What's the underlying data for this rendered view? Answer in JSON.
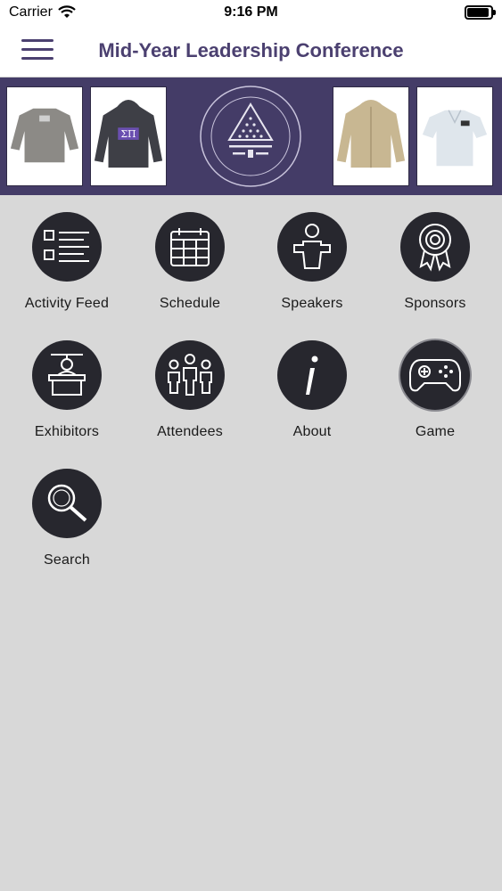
{
  "status": {
    "carrier": "Carrier",
    "time": "9:16 PM"
  },
  "nav": {
    "title": "Mid-Year Leadership Conference"
  },
  "banner": {
    "products": [
      "gray-sweatshirt",
      "hoodie-with-letters",
      "tan-jacket",
      "polo-shirt"
    ],
    "seal_text": "THE OFFICIAL STORE OF SIGMA PI FRATERNITY",
    "letters": "ΣΠ"
  },
  "menu": [
    {
      "label": "Activity Feed",
      "icon": "list-icon"
    },
    {
      "label": "Schedule",
      "icon": "calendar-icon"
    },
    {
      "label": "Speakers",
      "icon": "speaker-podium-icon"
    },
    {
      "label": "Sponsors",
      "icon": "award-ribbon-icon"
    },
    {
      "label": "Exhibitors",
      "icon": "exhibitor-booth-icon"
    },
    {
      "label": "Attendees",
      "icon": "people-group-icon"
    },
    {
      "label": "About",
      "icon": "info-icon"
    },
    {
      "label": "Game",
      "icon": "gamepad-icon"
    },
    {
      "label": "Search",
      "icon": "magnifier-icon"
    }
  ],
  "colors": {
    "accent": "#4b4070",
    "banner": "#443c67",
    "tile": "#27272e",
    "background": "#d8d8d8"
  }
}
